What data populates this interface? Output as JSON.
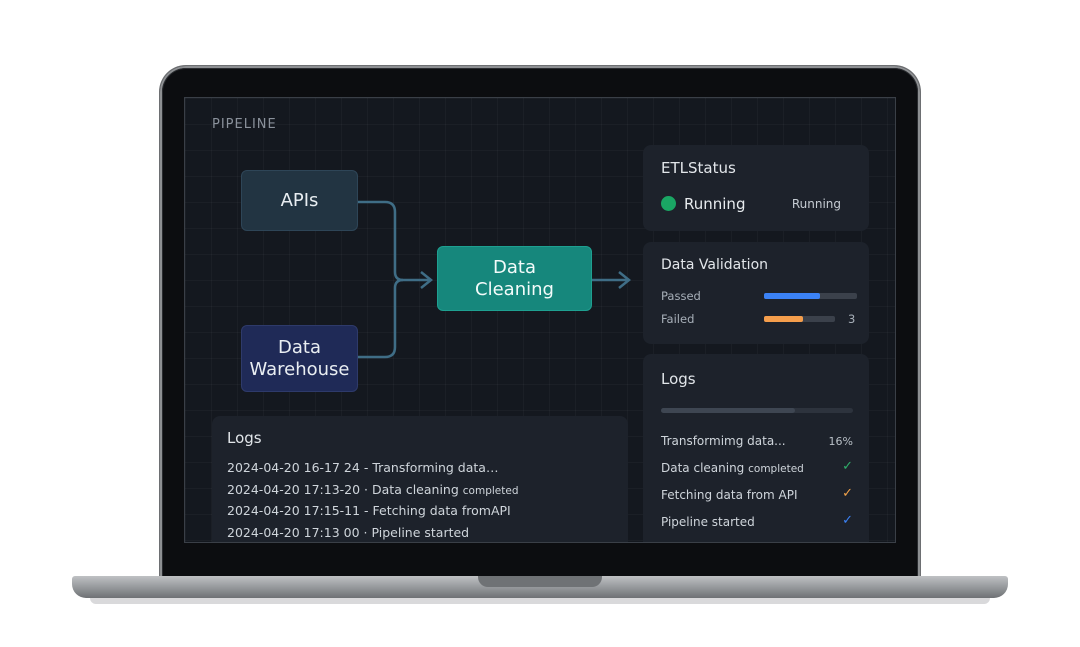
{
  "pipeline": {
    "section_label": "PIPELINE",
    "nodes": {
      "apis": "APIs",
      "warehouse_line1": "Data",
      "warehouse_line2": "Warehouse",
      "cleaning_line1": "Data",
      "cleaning_line2": "Cleaning"
    },
    "colors": {
      "apis": "#223442",
      "warehouse": "#1f2a57",
      "cleaning": "#16877c",
      "wire": "#3f6d86"
    }
  },
  "etl_status": {
    "title": "ETLStatus",
    "state": "Running",
    "badge": "Running",
    "dot_color": "#1aa664"
  },
  "data_validation": {
    "title": "Data Validation",
    "rows": [
      {
        "label": "Passed",
        "fraction": 0.6,
        "count": "",
        "color": "#3b82f6"
      },
      {
        "label": "Failed",
        "fraction": 0.55,
        "count": "3",
        "color": "#f59e4c"
      }
    ]
  },
  "logs_panel": {
    "title": "Logs",
    "progress_fraction": 0.7,
    "items": [
      {
        "text": "Transformimg data...",
        "right": "16%"
      },
      {
        "text": "Data cleaning",
        "small": "completed",
        "check": "✓",
        "check_color": "#2fae6a"
      },
      {
        "text": "Fetching data from API",
        "check": "✓",
        "check_color": "#f0a24a"
      },
      {
        "text": "Pipeline started",
        "check": "✓",
        "check_color": "#3b82f6"
      }
    ]
  },
  "logs_console": {
    "title": "Logs",
    "lines": [
      {
        "time": "2024-04-20 16-17 24",
        "sep": "-",
        "msg": "Transforming data…",
        "small": ""
      },
      {
        "time": "2024-04-20 17:13-20",
        "sep": "·",
        "msg": "Data cleaning",
        "small": "completed"
      },
      {
        "time": "2024-04-20 17:15-11",
        "sep": "-",
        "msg": "Fetching data fromAPI",
        "small": ""
      },
      {
        "time": "2024-04-20 17:13 00",
        "sep": "·",
        "msg": "Pipeline started",
        "small": ""
      }
    ]
  }
}
